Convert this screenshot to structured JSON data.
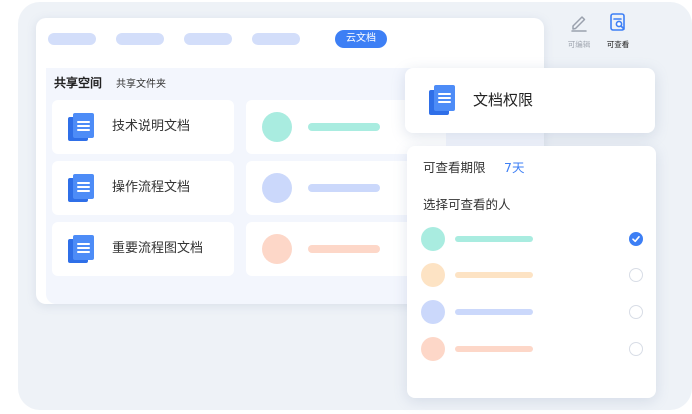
{
  "colors": {
    "accent": "#3d7ff5",
    "pill": "#d3defa",
    "mint": "#a9ece0",
    "mint_light": "#c4f2e9",
    "blue_soft": "#cbd8fb",
    "peach": "#fdd7c8",
    "peach_light": "#fcd0bd",
    "cream": "#fde3c4",
    "cream_light": "#fde1bd"
  },
  "topbar": {
    "active_tab": "云文档"
  },
  "breadcrumb": {
    "main": "共享空间",
    "sub": "共享文件夹"
  },
  "documents": [
    {
      "name": "技术说明文档",
      "icon": "document-icon"
    },
    {
      "name": "操作流程文档",
      "icon": "document-icon"
    },
    {
      "name": "重要流程图文档",
      "icon": "document-icon"
    }
  ],
  "permissions": {
    "title": "文档权限",
    "edit_label": "可编辑",
    "view_label": "可查看",
    "edit_icon": "pencil-icon",
    "view_icon": "view-doc-icon"
  },
  "access": {
    "period_label": "可查看期限",
    "period_value": "7天",
    "people_label": "选择可查看的人",
    "people": [
      {
        "checked": true
      },
      {
        "checked": false
      },
      {
        "checked": false
      },
      {
        "checked": false
      }
    ]
  }
}
